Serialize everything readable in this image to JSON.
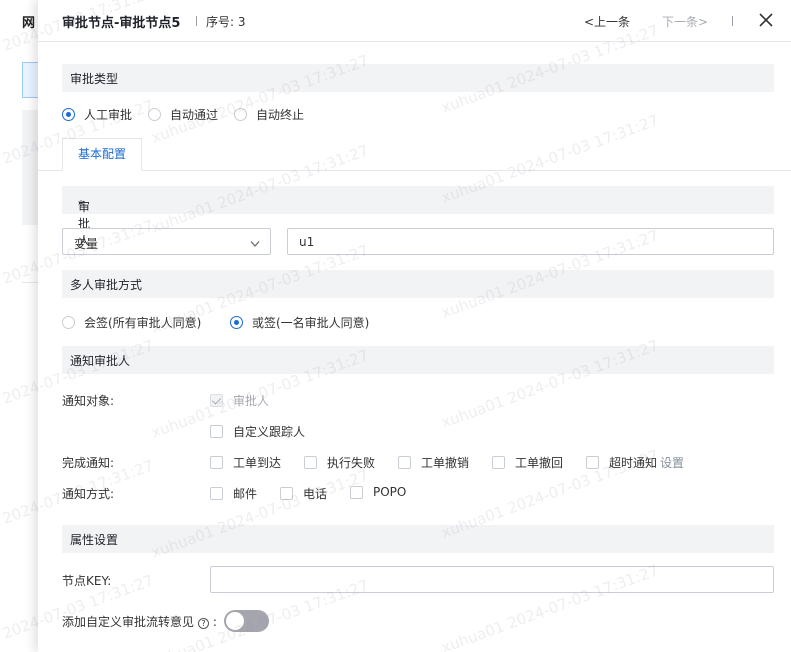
{
  "background_page": {
    "title_fragment": "网"
  },
  "drawer": {
    "title": "审批节点-审批节点5",
    "seq_label": "序号: 3",
    "prev_label": "<上一条",
    "next_label": "下一条>",
    "close_icon": "close-icon"
  },
  "approval_type": {
    "section_title": "审批类型",
    "options": [
      "人工审批",
      "自动通过",
      "自动终止"
    ],
    "selected": "人工审批"
  },
  "tabs": [
    {
      "label": "基本配置",
      "active": true
    }
  ],
  "approver": {
    "section_title": "审批人",
    "required": true,
    "required_mark": "*",
    "select_value": "变量",
    "input_value": "u1"
  },
  "multi_approval": {
    "section_title": "多人审批方式",
    "options": [
      "会签(所有审批人同意)",
      "或签(一名审批人同意)"
    ],
    "selected": "或签(一名审批人同意)"
  },
  "notify": {
    "section_title": "通知审批人",
    "target_label": "通知对象:",
    "targets": [
      {
        "label": "审批人",
        "checked": true,
        "disabled": true
      },
      {
        "label": "自定义跟踪人",
        "checked": false,
        "disabled": false
      }
    ],
    "complete_label": "完成通知:",
    "complete_options": [
      "工单到达",
      "执行失败",
      "工单撤销",
      "工单撤回",
      "超时通知"
    ],
    "settings_link": "设置",
    "method_label": "通知方式:",
    "method_options": [
      "邮件",
      "电话",
      "POPO"
    ]
  },
  "attributes": {
    "section_title": "属性设置",
    "node_key_label": "节点KEY:",
    "node_key_value": "",
    "custom_opinion_label": "添加自定义审批流转意见",
    "help_icon": "?",
    "colon": ":",
    "custom_opinion_enabled": false
  },
  "watermark": "xuhua01 2024-07-03 17:31:27",
  "colors": {
    "primary": "#1a6bd6",
    "section_bg": "#f2f3f5",
    "required": "#f53f3f",
    "toggle_off": "#a4a5ad"
  }
}
